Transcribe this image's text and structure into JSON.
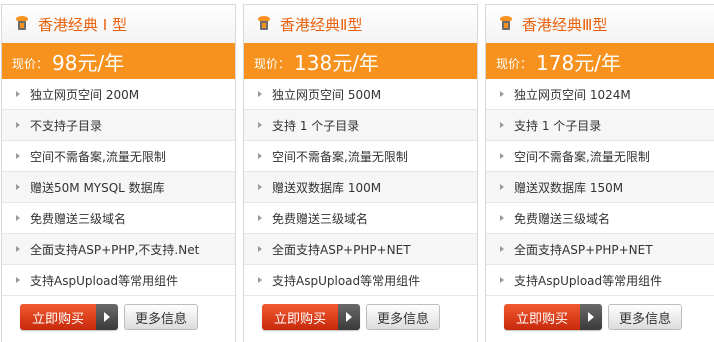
{
  "price_label": "现价：",
  "buy_label": "立即购买",
  "more_label": "更多信息",
  "plans": [
    {
      "name": "香港经典 I 型",
      "price": "98元/年",
      "features": [
        "独立网页空间 200M",
        "不支持子目录",
        "空间不需备案,流量无限制",
        "赠送50M MYSQL 数据库",
        "免费赠送三级域名",
        "全面支持ASP+PHP,不支持.Net",
        "支持AspUpload等常用组件"
      ]
    },
    {
      "name": "香港经典Ⅱ型",
      "price": "138元/年",
      "features": [
        "独立网页空间 500M",
        "支持 1 个子目录",
        "空间不需备案,流量无限制",
        "赠送双数据库 100M",
        "免费赠送三级域名",
        "全面支持ASP+PHP+NET",
        "支持AspUpload等常用组件"
      ]
    },
    {
      "name": "香港经典Ⅲ型",
      "price": "178元/年",
      "features": [
        "独立网页空间 1024M",
        "支持 1 个子目录",
        "空间不需备案,流量无限制",
        "赠送双数据库 150M",
        "免费赠送三级域名",
        "全面支持ASP+PHP+NET",
        "支持AspUpload等常用组件"
      ]
    }
  ],
  "colors": {
    "accent": "#f7921e",
    "title": "#e8620e",
    "buy": "#d9381a"
  }
}
